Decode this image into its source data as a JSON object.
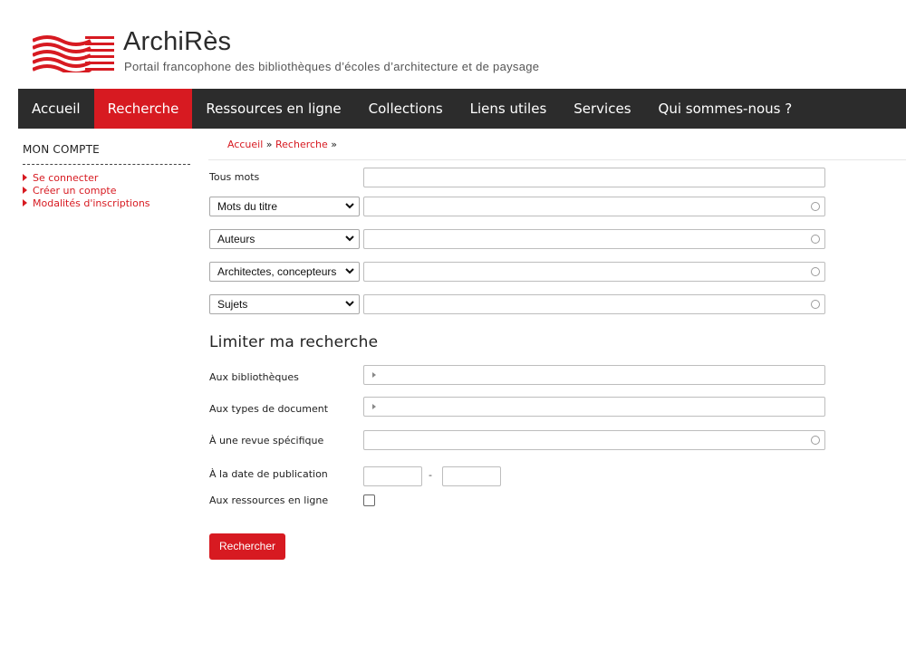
{
  "brand": {
    "title": "ArchiRès",
    "subtitle": "Portail francophone des bibliothèques d’écoles d’architecture et de paysage",
    "accent_color": "#d71a21"
  },
  "nav": {
    "items": [
      {
        "label": "Accueil",
        "active": false
      },
      {
        "label": "Recherche",
        "active": true
      },
      {
        "label": "Ressources en ligne",
        "active": false
      },
      {
        "label": "Collections",
        "active": false
      },
      {
        "label": "Liens utiles",
        "active": false
      },
      {
        "label": "Services",
        "active": false
      },
      {
        "label": "Qui sommes-nous ?",
        "active": false
      }
    ]
  },
  "sidebar": {
    "title": "MON COMPTE",
    "items": [
      {
        "label": "Se connecter"
      },
      {
        "label": "Créer un compte"
      },
      {
        "label": "Modalités d'inscriptions"
      }
    ]
  },
  "breadcrumb": {
    "home": "Accueil",
    "sep1": " » ",
    "current": "Recherche",
    "sep2": " »"
  },
  "search": {
    "all_words_label": "Tous mots",
    "all_words_value": "",
    "fields": [
      {
        "selected": "Mots du titre",
        "value": ""
      },
      {
        "selected": "Auteurs",
        "value": ""
      },
      {
        "selected": "Architectes, concepteurs",
        "value": ""
      },
      {
        "selected": "Sujets",
        "value": ""
      }
    ]
  },
  "limits": {
    "title": "Limiter ma recherche",
    "libraries_label": "Aux bibliothèques",
    "doc_types_label": "Aux types de document",
    "journal_label": "À une revue spécifique",
    "date_label": "À la date de publication",
    "date_from": "",
    "date_separator": "-",
    "date_to": "",
    "online_label": "Aux ressources en ligne",
    "online_checked": false
  },
  "submit_label": "Rechercher",
  "icons": {
    "logo": "archires-waves-logo",
    "select_arrow": "chevron-down-icon",
    "autocomplete": "ring-icon",
    "expand": "triangle-right-icon",
    "bullet": "arrow-bullet-icon"
  }
}
